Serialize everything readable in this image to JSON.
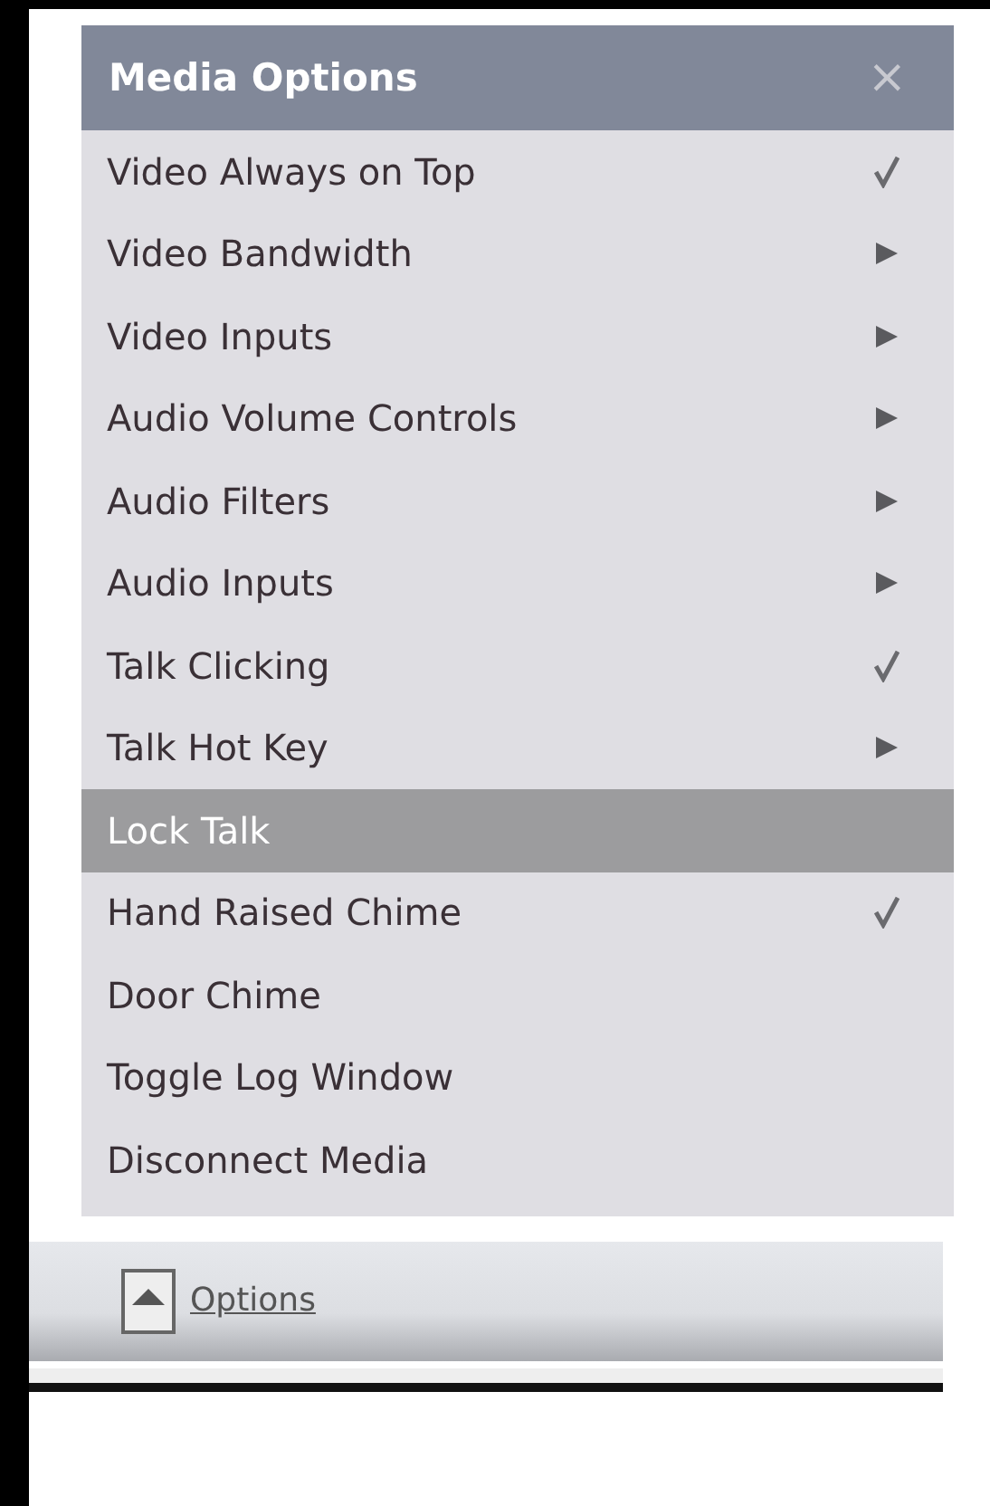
{
  "menu": {
    "title": "Media Options",
    "close": "×",
    "items": [
      {
        "label": "Video Always on Top",
        "kind": "check",
        "checked": true,
        "selected": false
      },
      {
        "label": "Video Bandwidth",
        "kind": "submenu",
        "selected": false
      },
      {
        "label": "Video Inputs",
        "kind": "submenu",
        "selected": false
      },
      {
        "label": "Audio Volume Controls",
        "kind": "submenu",
        "selected": false
      },
      {
        "label": "Audio Filters",
        "kind": "submenu",
        "selected": false
      },
      {
        "label": "Audio Inputs",
        "kind": "submenu",
        "selected": false
      },
      {
        "label": "Talk Clicking",
        "kind": "check",
        "checked": true,
        "selected": false
      },
      {
        "label": "Talk Hot Key",
        "kind": "submenu",
        "selected": false
      },
      {
        "label": "Lock Talk",
        "kind": "action",
        "selected": true
      },
      {
        "label": "Hand Raised Chime",
        "kind": "check",
        "checked": true,
        "selected": false
      },
      {
        "label": "Door Chime",
        "kind": "action",
        "selected": false
      },
      {
        "label": "Toggle Log Window",
        "kind": "action",
        "selected": false
      },
      {
        "label": "Disconnect Media",
        "kind": "action",
        "selected": false
      }
    ]
  },
  "footer": {
    "link": "Options"
  }
}
